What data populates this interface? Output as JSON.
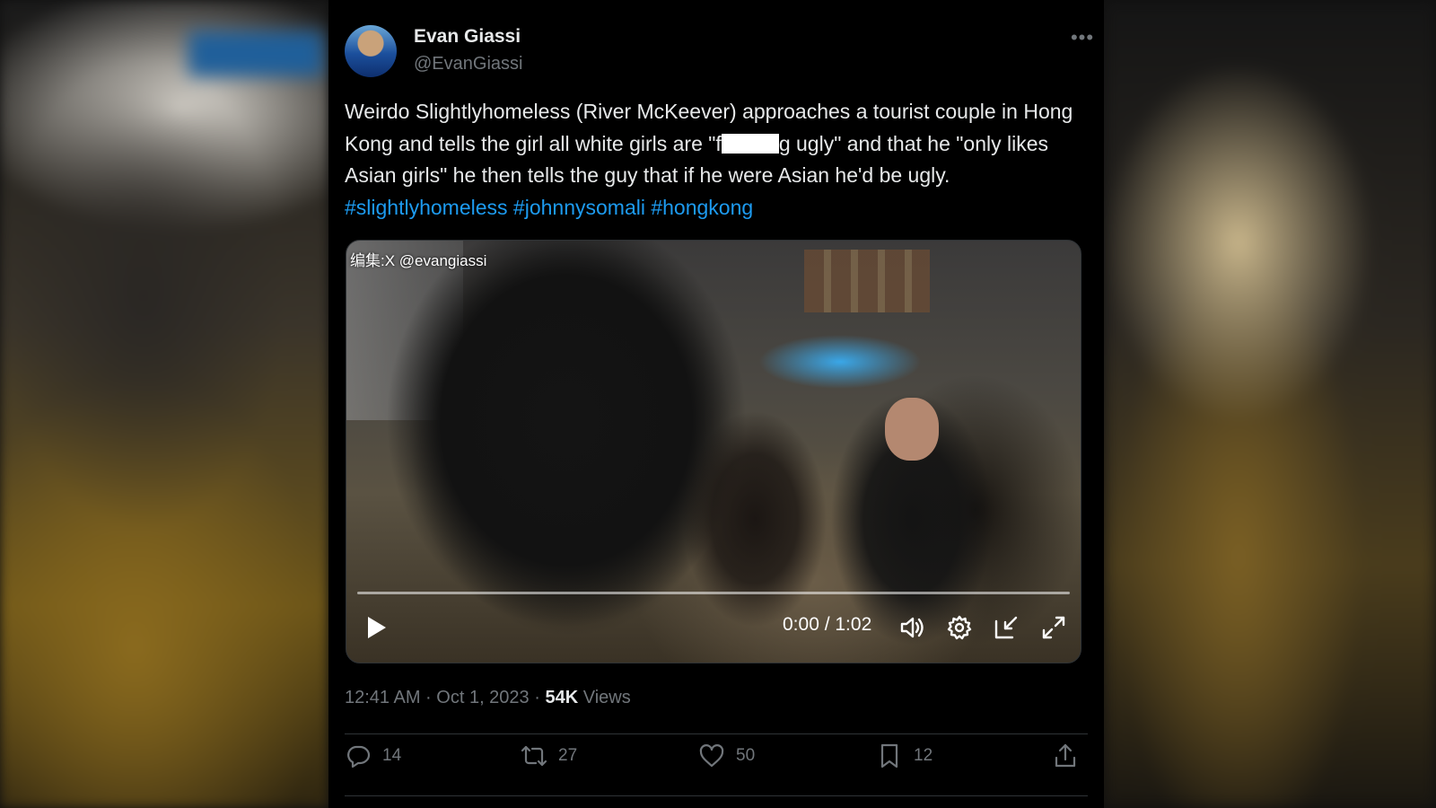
{
  "tweet": {
    "author_name": "Evan Giassi",
    "author_handle": "@EvanGiassi",
    "text_before_redaction": "Weirdo Slightlyhomeless (River McKeever) approaches a tourist couple in Hong Kong and tells the girl all white girls are \"f",
    "text_after_redaction": "g ugly\" and that he \"only likes Asian girls\" he then tells the guy that if he were Asian he'd be ugly.",
    "hashtags": [
      "#slightlyhomeless",
      "#johnnysomali",
      "#hongkong"
    ],
    "timestamp": "12:41 AM · Oct 1, 2023",
    "views_count": "54K",
    "views_label": "Views"
  },
  "video": {
    "watermark": "编集:X @evangiassi",
    "time_display": "0:00 / 1:02",
    "progress": 0
  },
  "actions": {
    "replies": "14",
    "reposts": "27",
    "likes": "50",
    "bookmarks": "12"
  },
  "icons": {
    "more": "more-options-icon",
    "play": "play-icon",
    "volume": "volume-icon",
    "settings": "gear-icon",
    "pip": "picture-in-picture-icon",
    "fullscreen": "fullscreen-icon",
    "reply": "reply-icon",
    "repost": "repost-icon",
    "like": "heart-icon",
    "bookmark": "bookmark-icon",
    "share": "share-icon"
  },
  "colors": {
    "background": "#000000",
    "text": "#e7e9ea",
    "secondary": "#71767b",
    "link": "#1d9bf0"
  }
}
